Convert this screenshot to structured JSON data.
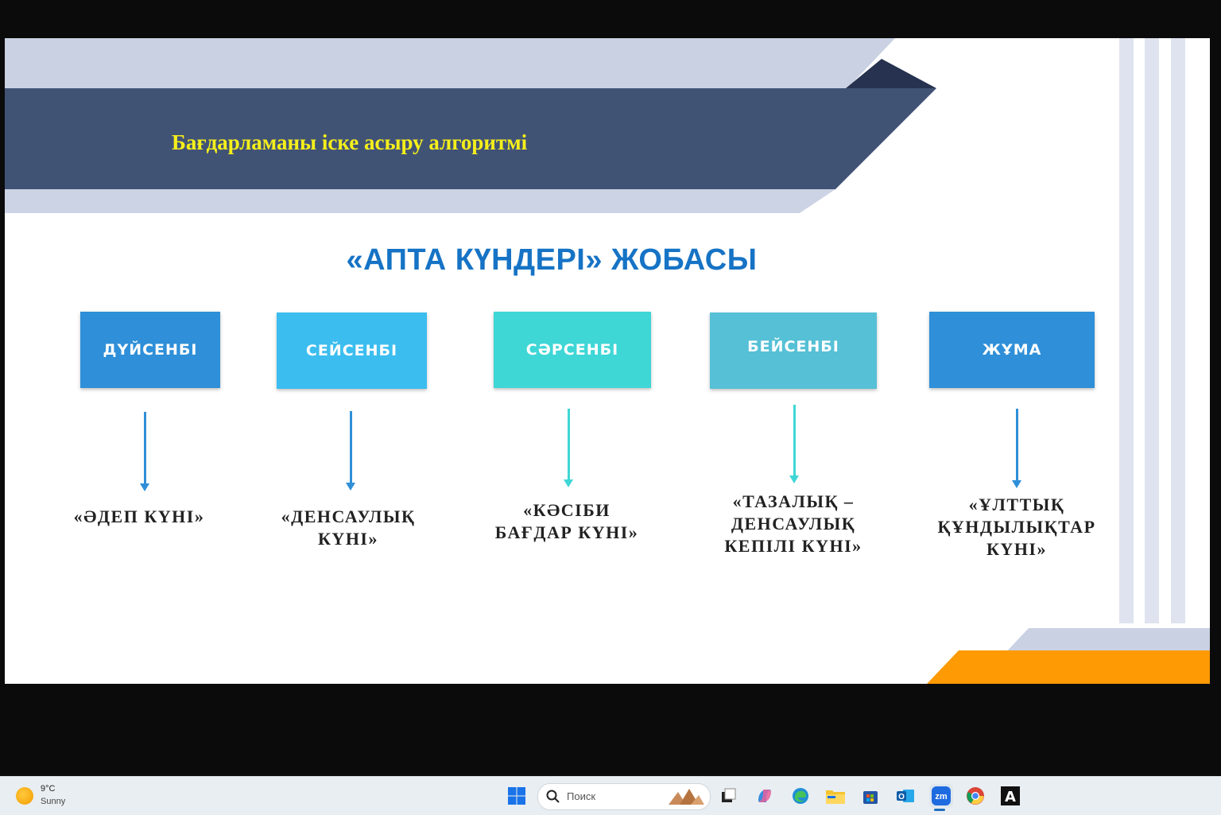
{
  "slide": {
    "title": "Бағдарламаны іске асыру алгоритмі",
    "project_title": "«АПТА КҮНДЕРІ» ЖОБАСЫ",
    "days": [
      {
        "name": "ДҮЙСЕНБІ",
        "label": "«ӘДЕП КҮНІ»",
        "color": "#2f8fd8"
      },
      {
        "name": "СЕЙСЕНБІ",
        "label": "«ДЕНСАУЛЫҚ\nКҮНІ»",
        "color": "#3bbdef"
      },
      {
        "name": "СӘРСЕНБІ",
        "label": "«КӘСІБИ\nБАҒДАР КҮНІ»",
        "color": "#3fd6d6"
      },
      {
        "name": "БЕЙСЕНБІ",
        "label": "«ТАЗАЛЫҚ –\nДЕНСАУЛЫҚ\nКЕПІЛІ КҮНІ»",
        "color": "#56c0d6"
      },
      {
        "name": "ЖҰМА",
        "label": "«ҰЛТТЫҚ\nҚҰНДЫЛЫҚТАР\nКҮНІ»",
        "color": "#2f8fd8"
      }
    ],
    "colors": {
      "banner": "#415375",
      "banner_light": "#c9d1e3",
      "title_text": "#f5ef1b",
      "project_title": "#1673c5",
      "accent_orange": "#fd9a04"
    }
  },
  "taskbar": {
    "weather": {
      "temp": "9°C",
      "condition": "Sunny",
      "icon": "sun-icon"
    },
    "search_placeholder": "Поиск",
    "apps": [
      "start-icon",
      "search-icon",
      "task-view-icon",
      "copilot-icon",
      "edge-icon",
      "file-explorer-icon",
      "store-icon",
      "outlook-icon",
      "zoom-icon",
      "chrome-icon",
      "font-app-icon"
    ],
    "zoom_label": "zm",
    "outlook_label": "O",
    "font_app_label": "A"
  }
}
